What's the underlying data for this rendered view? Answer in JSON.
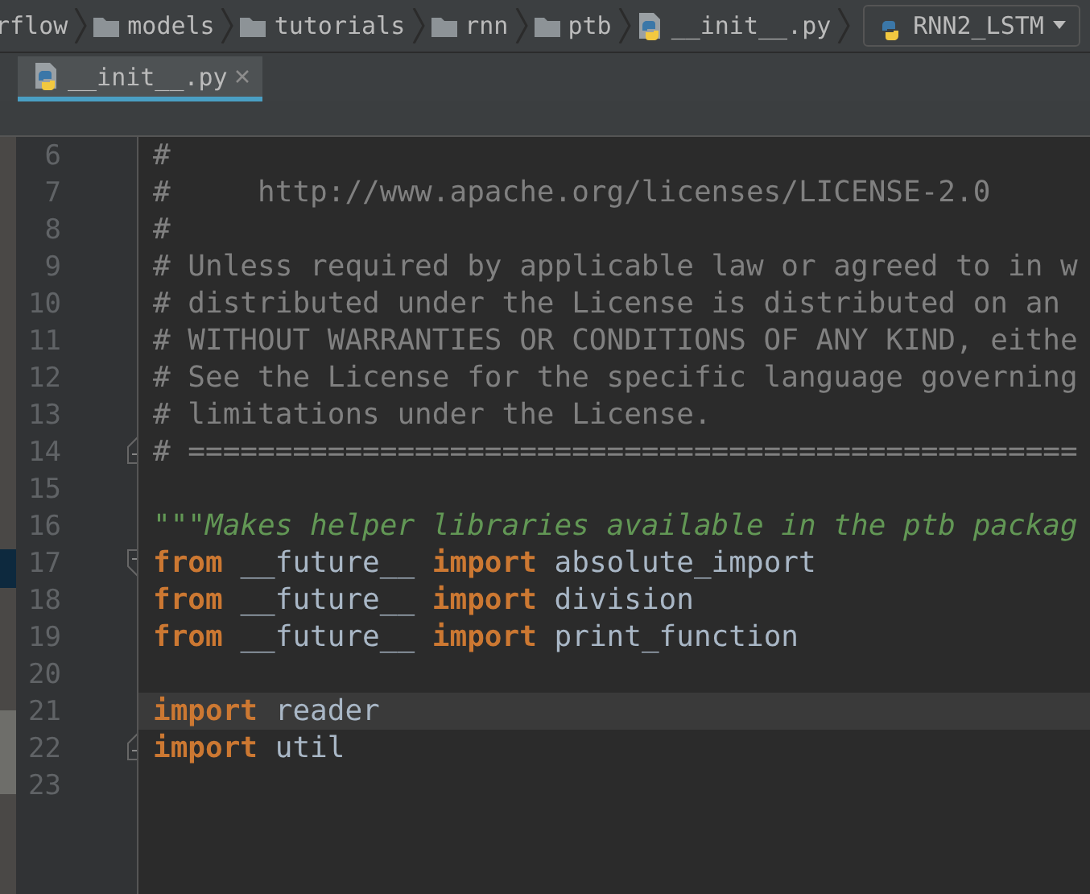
{
  "breadcrumbs": [
    {
      "label": "rflow"
    },
    {
      "label": "models",
      "kind": "folder"
    },
    {
      "label": "tutorials",
      "kind": "folder"
    },
    {
      "label": "rnn",
      "kind": "folder"
    },
    {
      "label": "ptb",
      "kind": "folder"
    },
    {
      "label": "__init__.py",
      "kind": "python"
    }
  ],
  "run_config": {
    "label": "RNN2_LSTM"
  },
  "tabs": [
    {
      "label": "__init__.py",
      "selected": true
    }
  ],
  "lines": [
    {
      "number": "6",
      "kind": "line",
      "tokens": [
        {
          "kind": "comment",
          "text": "#"
        }
      ]
    },
    {
      "number": "7",
      "kind": "line",
      "tokens": [
        {
          "kind": "comment",
          "text": "#     http://www.apache.org/licenses/LICENSE-2.0"
        }
      ]
    },
    {
      "number": "8",
      "kind": "line",
      "tokens": [
        {
          "kind": "comment",
          "text": "#"
        }
      ]
    },
    {
      "number": "9",
      "kind": "line",
      "tokens": [
        {
          "kind": "comment",
          "text": "# Unless required by applicable law or agreed to in w"
        }
      ]
    },
    {
      "number": "10",
      "kind": "line",
      "tokens": [
        {
          "kind": "comment",
          "text": "# distributed under the License is distributed on an"
        }
      ]
    },
    {
      "number": "11",
      "kind": "line",
      "tokens": [
        {
          "kind": "comment",
          "text": "# WITHOUT WARRANTIES OR CONDITIONS OF ANY KIND, eithe"
        }
      ]
    },
    {
      "number": "12",
      "kind": "line",
      "tokens": [
        {
          "kind": "comment",
          "text": "# See the License for the specific language governing"
        }
      ]
    },
    {
      "number": "13",
      "kind": "line",
      "tokens": [
        {
          "kind": "comment",
          "text": "# limitations under the License."
        }
      ]
    },
    {
      "number": "14",
      "kind": "fold_end",
      "tokens": [
        {
          "kind": "comment",
          "text": "# ==================================================="
        }
      ]
    },
    {
      "number": "15",
      "kind": "line"
    },
    {
      "number": "16",
      "kind": "line",
      "tokens": [
        {
          "kind": "docstring",
          "text": "\"\"\"Makes helper libraries available in the ptb packag"
        }
      ]
    },
    {
      "number": "17",
      "kind": "fold_start",
      "tokens": [
        {
          "kind": "keyword",
          "text": "from"
        },
        {
          "kind": "plain",
          "text": " __future__ "
        },
        {
          "kind": "keyword",
          "text": "import"
        },
        {
          "kind": "plain",
          "text": " absolute_import"
        }
      ]
    },
    {
      "number": "18",
      "kind": "line",
      "tokens": [
        {
          "kind": "keyword",
          "text": "from"
        },
        {
          "kind": "plain",
          "text": " __future__ "
        },
        {
          "kind": "keyword",
          "text": "import"
        },
        {
          "kind": "plain",
          "text": " division"
        }
      ]
    },
    {
      "number": "19",
      "kind": "line",
      "tokens": [
        {
          "kind": "keyword",
          "text": "from"
        },
        {
          "kind": "plain",
          "text": " __future__ "
        },
        {
          "kind": "keyword",
          "text": "import"
        },
        {
          "kind": "plain",
          "text": " print_function"
        }
      ]
    },
    {
      "number": "20",
      "kind": "line"
    },
    {
      "number": "21",
      "kind": "line",
      "current": true,
      "tokens": [
        {
          "kind": "keyword",
          "text": "import"
        },
        {
          "kind": "plain",
          "text": " reader"
        }
      ]
    },
    {
      "number": "22",
      "kind": "fold_end",
      "tokens": [
        {
          "kind": "keyword",
          "text": "import"
        },
        {
          "kind": "plain",
          "text": " util"
        }
      ]
    },
    {
      "number": "23",
      "kind": "line"
    }
  ]
}
